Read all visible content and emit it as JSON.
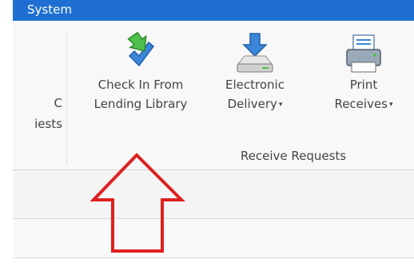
{
  "title_bar": {
    "text": "System"
  },
  "left_group": {
    "line1": "C",
    "line2": "iests"
  },
  "ribbon": {
    "buttons": [
      {
        "line1": "Check In From",
        "line2": "Lending Library",
        "icon": "check-in-icon",
        "dropdown": false
      },
      {
        "line1": "Electronic",
        "line2": "Delivery",
        "icon": "electronic-delivery-icon",
        "dropdown": true
      },
      {
        "line1": "Print",
        "line2": "Receives",
        "icon": "printer-icon",
        "dropdown": true
      }
    ],
    "group_label": "Receive Requests"
  },
  "dropdown_glyph": "▾",
  "annotation": {
    "type": "up-arrow",
    "color": "#e02020"
  },
  "colors": {
    "title_bar": "#1f6fd2",
    "ribbon_bg": "#f8f8f8",
    "annotation": "#e02020"
  }
}
